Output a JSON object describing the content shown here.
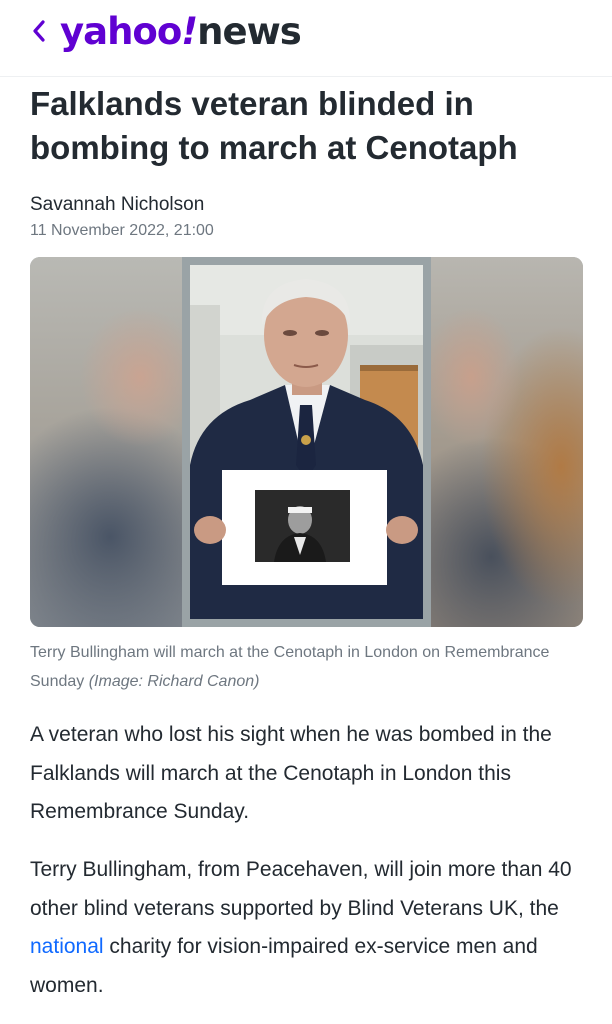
{
  "header": {
    "back_icon": "chevron-left-icon",
    "logo_brand": "yahoo",
    "logo_bang": "!",
    "logo_section": "news",
    "brand_color": "#6001d2"
  },
  "article": {
    "headline": "Falklands veteran blinded in bombing to march at Cenotaph",
    "author": "Savannah Nicholson",
    "date": "11 November 2022, 21:00",
    "image": {
      "caption": "Terry Bullingham will march at the Cenotaph in London on Remembrance Sunday",
      "credit": "(Image: Richard Canon)"
    },
    "paragraph1": "A veteran who lost his sight when he was bombed in the Falklands will march at the Cenotaph in London this Remembrance Sunday.",
    "paragraph2": {
      "before_link": "Terry Bullingham, from Peacehaven, will join more than 40 other blind veterans supported by Blind Veterans UK, the ",
      "link_text": "national",
      "after_link": " charity for vision-impaired ex-service men and women.",
      "link_color": "#0f69ff"
    }
  }
}
